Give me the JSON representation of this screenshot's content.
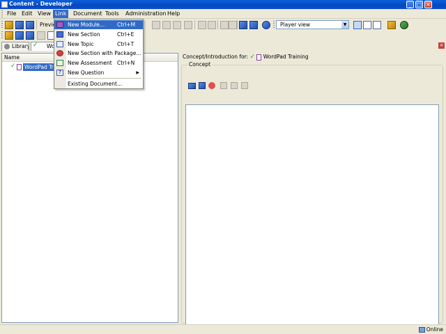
{
  "window": {
    "title": "Content - Developer",
    "controls": {
      "minimize": "_",
      "maximize": "□",
      "close": "×"
    }
  },
  "menubar": {
    "items": [
      "File",
      "Edit",
      "View",
      "Link",
      "Document",
      "Tools",
      "Administration",
      "Help"
    ],
    "active": "Link"
  },
  "toolbar": {
    "preview_label": "Previe",
    "player_view": "Player view"
  },
  "tabs": {
    "library": "Library",
    "document": "Wor"
  },
  "left_pane": {
    "column_header": "Name",
    "tree_node": "WordPad Trai"
  },
  "right_pane": {
    "concept_for_label": "Concept/Introduction for:",
    "concept_for_value": "WordPad Training",
    "group_title": "Concept"
  },
  "link_menu": {
    "items": [
      {
        "label": "New Module...",
        "shortcut": "Ctrl+M",
        "icon": "module-icon"
      },
      {
        "label": "New Section",
        "shortcut": "Ctrl+E",
        "icon": "section-icon"
      },
      {
        "label": "New Topic",
        "shortcut": "Ctrl+T",
        "icon": "topic-icon"
      },
      {
        "label": "New Section with Package...",
        "shortcut": "",
        "icon": "package-icon"
      },
      {
        "label": "New Assessment",
        "shortcut": "Ctrl+N",
        "icon": "assessment-icon"
      },
      {
        "label": "New Question",
        "shortcut": "",
        "icon": "question-icon",
        "submenu": true
      },
      {
        "label": "Existing Document...",
        "shortcut": "",
        "icon": ""
      }
    ]
  },
  "statusbar": {
    "status": "Online"
  },
  "colors": {
    "selection": "#316ac5",
    "titlebar": "#0548c0",
    "check": "#2a9a2a"
  }
}
